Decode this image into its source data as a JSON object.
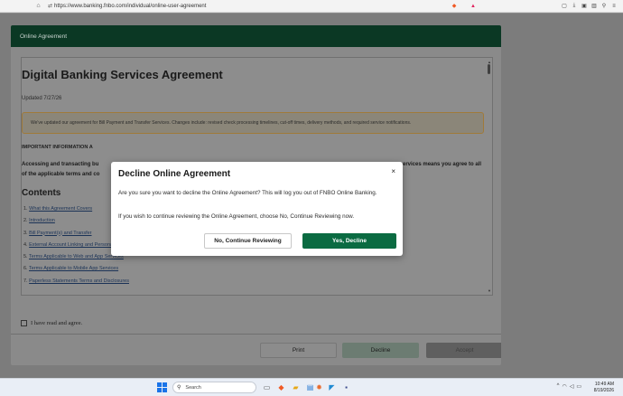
{
  "browser": {
    "url": "https://www.banking.fnbo.com/individual/online-user-agreement"
  },
  "card": {
    "header_title": "Online Agreement",
    "doc": {
      "title": "Digital Banking Services Agreement",
      "updated": "Updated 7/27/26",
      "notice": "We've updated our agreement for Bill Payment and Transfer Services. Changes include: revised check processing timelines, cut-off times, delivery methods, and required service notifications.",
      "important": "IMPORTANT INFORMATION A",
      "accessing_left": "Accessing and transacting bu",
      "accessing_right": "ervices means you agree to all",
      "applicable": "of the applicable terms and co",
      "contents_heading": "Contents",
      "toc": [
        {
          "num": "1.",
          "label": "What this Agreement Covers"
        },
        {
          "num": "2.",
          "label": "Introduction"
        },
        {
          "num": "3.",
          "label": "Bill Payment(s) and Transfer"
        },
        {
          "num": "4.",
          "label": "External Account Linking and Personal Financial Management Tools"
        },
        {
          "num": "5.",
          "label": "Terms Applicable to Web and App Services"
        },
        {
          "num": "6.",
          "label": "Terms Applicable to Mobile App Services"
        },
        {
          "num": "7.",
          "label": "Paperless Statements Terms and Disclosures"
        }
      ]
    },
    "agree_label": "I have read and agree.",
    "buttons": {
      "print": "Print",
      "decline": "Decline",
      "accept": "Accept"
    }
  },
  "modal": {
    "title": "Decline Online Agreement",
    "close": "×",
    "message1": "Are you sure you want to decline the Online Agreement? This will log you out of FNBO Online Banking.",
    "message2": "If you wish to continue reviewing the Online Agreement, choose No, Continue Reviewing now.",
    "no_button": "No, Continue Reviewing",
    "yes_button": "Yes, Decline"
  },
  "taskbar": {
    "search_placeholder": "Search",
    "time": "10:49 AM",
    "date": "8/19/2026"
  },
  "colors": {
    "header_green": "#0b3824",
    "primary_green": "#0b6b42"
  }
}
